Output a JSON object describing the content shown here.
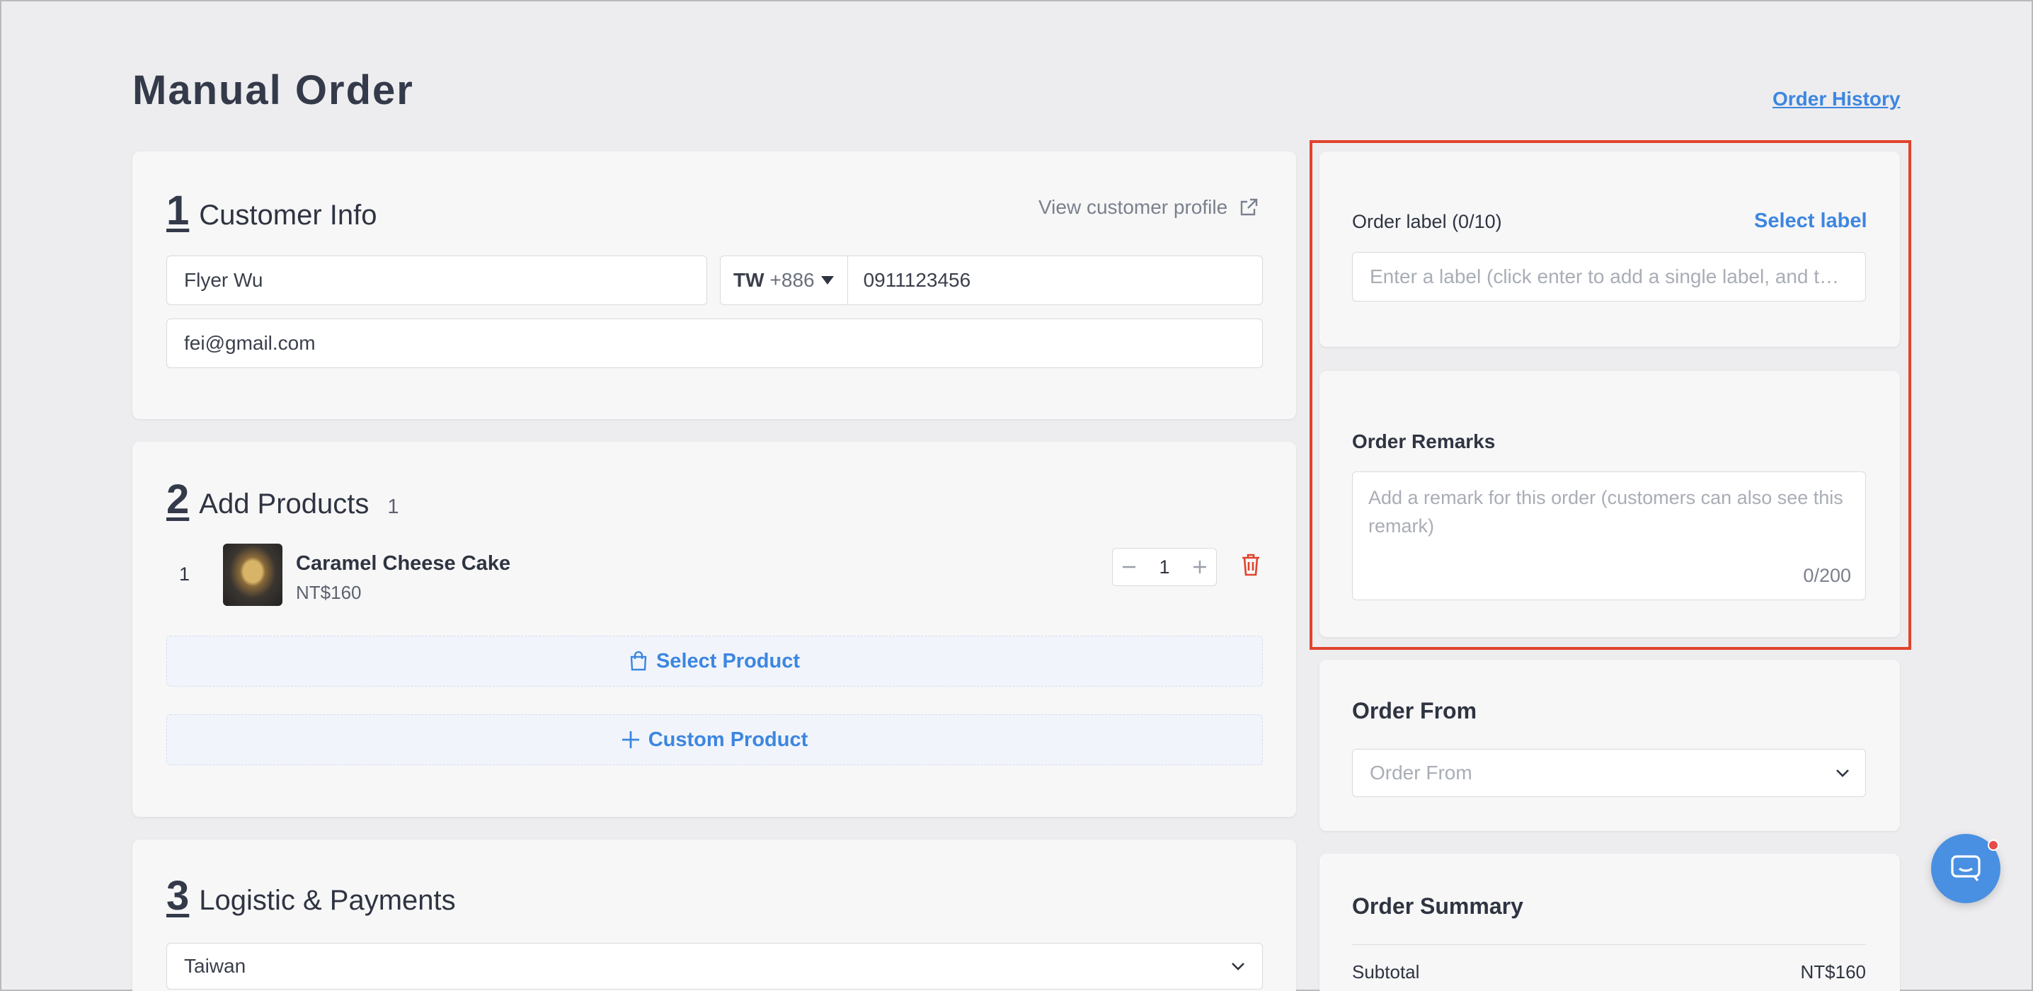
{
  "page": {
    "title": "Manual Order",
    "history_link": "Order History"
  },
  "customer": {
    "number": "1",
    "title": "Customer Info",
    "profile_link": "View customer profile",
    "name": "Flyer Wu",
    "country_code": "TW",
    "dial_code": "+886",
    "phone": "0911123456",
    "email": "fei@gmail.com"
  },
  "products": {
    "number": "2",
    "title": "Add Products",
    "count": "1",
    "items": [
      {
        "index": "1",
        "name": "Caramel Cheese Cake",
        "price": "NT$160",
        "qty": "1"
      }
    ],
    "select_label": "Select Product",
    "custom_label": "Custom Product"
  },
  "logistics": {
    "number": "3",
    "title": "Logistic & Payments",
    "country": "Taiwan"
  },
  "label_panel": {
    "label": "Order label (0/10)",
    "select": "Select label",
    "placeholder": "Enter a label (click enter to add a single label, and t…"
  },
  "remarks": {
    "title": "Order Remarks",
    "placeholder": "Add a remark for this order (customers can also see this remark)",
    "counter": "0/200"
  },
  "order_from": {
    "title": "Order From",
    "placeholder": "Order From"
  },
  "summary": {
    "title": "Order Summary",
    "subtotal_label": "Subtotal",
    "subtotal_value": "NT$160"
  },
  "colors": {
    "accent": "#3d86e0",
    "highlight": "#e0432d",
    "delete": "#e0432d"
  }
}
